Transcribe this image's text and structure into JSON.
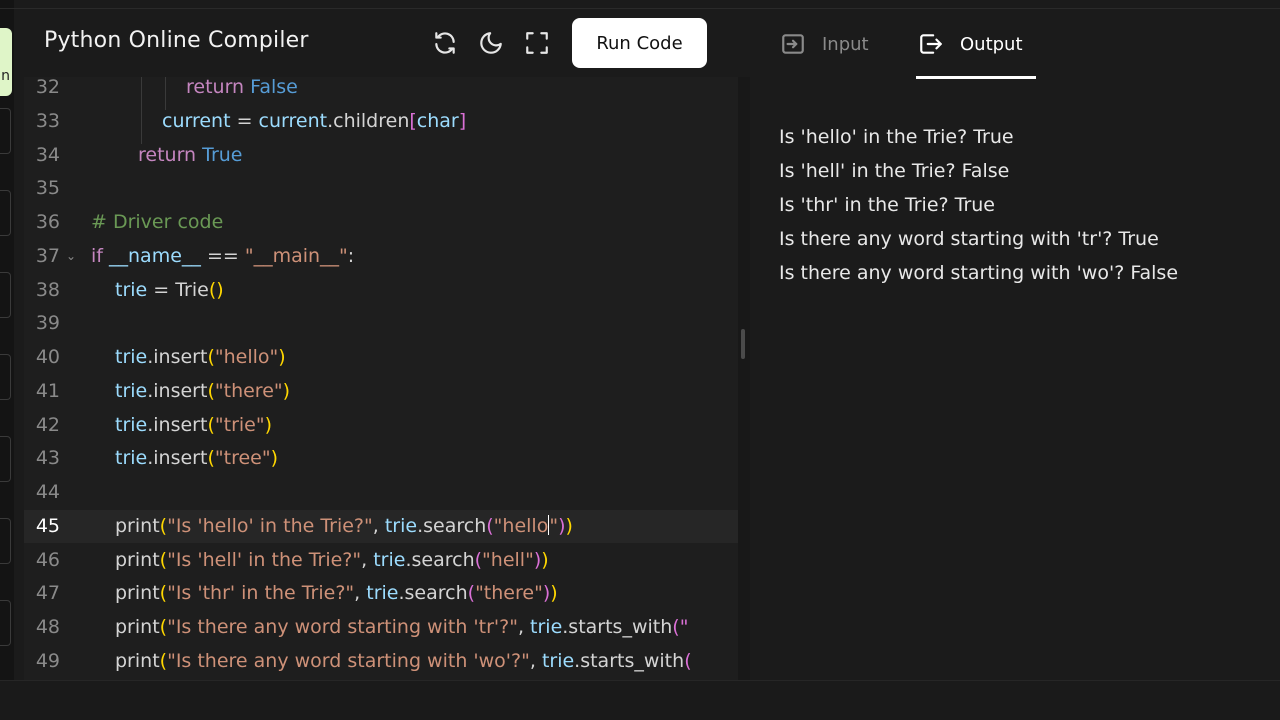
{
  "sidebar": {
    "badge_glyph": "n"
  },
  "header": {
    "title": "Python Online Compiler",
    "icons": [
      "refresh-icon",
      "moon-icon",
      "fullscreen-icon"
    ],
    "run_label": "Run Code"
  },
  "editor": {
    "active_line": "45",
    "lines": [
      {
        "no": "32",
        "t": [
          [
            "kw",
            "return "
          ],
          [
            "const",
            "False"
          ]
        ]
      },
      {
        "no": "33",
        "t": [
          [
            "var",
            "current"
          ],
          [
            "plain",
            " = "
          ],
          [
            "var",
            "current"
          ],
          [
            "plain",
            ".children"
          ],
          [
            "br2",
            "["
          ],
          [
            "var",
            "char"
          ],
          [
            "br2",
            "]"
          ]
        ]
      },
      {
        "no": "34",
        "t": [
          [
            "kw",
            "return "
          ],
          [
            "const",
            "True"
          ]
        ]
      },
      {
        "no": "35",
        "t": []
      },
      {
        "no": "36",
        "t": [
          [
            "com",
            "# Driver code"
          ]
        ]
      },
      {
        "no": "37",
        "t": [
          [
            "kw",
            "if "
          ],
          [
            "var",
            "__name__"
          ],
          [
            "plain",
            " == "
          ],
          [
            "str",
            "\"__main__\""
          ],
          [
            "plain",
            ":"
          ]
        ]
      },
      {
        "no": "38",
        "t": [
          [
            "var",
            "trie"
          ],
          [
            "plain",
            " = "
          ],
          [
            "plain",
            "Trie"
          ],
          [
            "br1",
            "()"
          ]
        ]
      },
      {
        "no": "39",
        "t": []
      },
      {
        "no": "40",
        "t": [
          [
            "var",
            "trie"
          ],
          [
            "plain",
            ".insert"
          ],
          [
            "br1",
            "("
          ],
          [
            "str",
            "\"hello\""
          ],
          [
            "br1",
            ")"
          ]
        ]
      },
      {
        "no": "41",
        "t": [
          [
            "var",
            "trie"
          ],
          [
            "plain",
            ".insert"
          ],
          [
            "br1",
            "("
          ],
          [
            "str",
            "\"there\""
          ],
          [
            "br1",
            ")"
          ]
        ]
      },
      {
        "no": "42",
        "t": [
          [
            "var",
            "trie"
          ],
          [
            "plain",
            ".insert"
          ],
          [
            "br1",
            "("
          ],
          [
            "str",
            "\"trie\""
          ],
          [
            "br1",
            ")"
          ]
        ]
      },
      {
        "no": "43",
        "t": [
          [
            "var",
            "trie"
          ],
          [
            "plain",
            ".insert"
          ],
          [
            "br1",
            "("
          ],
          [
            "str",
            "\"tree\""
          ],
          [
            "br1",
            ")"
          ]
        ]
      },
      {
        "no": "44",
        "t": []
      },
      {
        "no": "45",
        "t": [
          [
            "plain",
            "print"
          ],
          [
            "br1",
            "("
          ],
          [
            "str",
            "\"Is 'hello' in the Trie?\""
          ],
          [
            "plain",
            ", "
          ],
          [
            "var",
            "trie"
          ],
          [
            "plain",
            ".search"
          ],
          [
            "br2",
            "("
          ],
          [
            "str",
            "\"hello"
          ],
          [
            "cursor",
            ""
          ],
          [
            "str",
            "\""
          ],
          [
            "br2",
            ")"
          ],
          [
            "br1",
            ")"
          ]
        ]
      },
      {
        "no": "46",
        "t": [
          [
            "plain",
            "print"
          ],
          [
            "br1",
            "("
          ],
          [
            "str",
            "\"Is 'hell' in the Trie?\""
          ],
          [
            "plain",
            ", "
          ],
          [
            "var",
            "trie"
          ],
          [
            "plain",
            ".search"
          ],
          [
            "br2",
            "("
          ],
          [
            "str",
            "\"hell\""
          ],
          [
            "br2",
            ")"
          ],
          [
            "br1",
            ")"
          ]
        ]
      },
      {
        "no": "47",
        "t": [
          [
            "plain",
            "print"
          ],
          [
            "br1",
            "("
          ],
          [
            "str",
            "\"Is 'thr' in the Trie?\""
          ],
          [
            "plain",
            ", "
          ],
          [
            "var",
            "trie"
          ],
          [
            "plain",
            ".search"
          ],
          [
            "br2",
            "("
          ],
          [
            "str",
            "\"there\""
          ],
          [
            "br2",
            ")"
          ],
          [
            "br1",
            ")"
          ]
        ]
      },
      {
        "no": "48",
        "t": [
          [
            "plain",
            "print"
          ],
          [
            "br1",
            "("
          ],
          [
            "str",
            "\"Is there any word starting with 'tr'?\""
          ],
          [
            "plain",
            ", "
          ],
          [
            "var",
            "trie"
          ],
          [
            "plain",
            ".starts_with"
          ],
          [
            "br2",
            "(\""
          ]
        ]
      },
      {
        "no": "49",
        "t": [
          [
            "plain",
            "print"
          ],
          [
            "br1",
            "("
          ],
          [
            "str",
            "\"Is there any word starting with 'wo'?\""
          ],
          [
            "plain",
            ", "
          ],
          [
            "var",
            "trie"
          ],
          [
            "plain",
            ".starts_with"
          ],
          [
            "br2",
            "("
          ]
        ]
      }
    ]
  },
  "io": {
    "tabs": {
      "input": "Input",
      "output": "Output"
    },
    "active_tab": "Output",
    "output_lines": [
      "Is 'hello' in the Trie? True",
      "Is 'hell' in the Trie? False",
      "Is 'thr' in the Trie? True",
      "Is there any word starting with 'tr'? True",
      "Is there any word starting with 'wo'? False"
    ]
  },
  "colors": {
    "background": "#1b1b1b",
    "editor_bg": "#1e1e1e",
    "keyword": "#c586c0",
    "constant": "#569cd6",
    "variable": "#9cdcfe",
    "string": "#ce9178",
    "comment": "#6a9955",
    "bracket": "#ffd700",
    "run_button": "#ffffff"
  }
}
